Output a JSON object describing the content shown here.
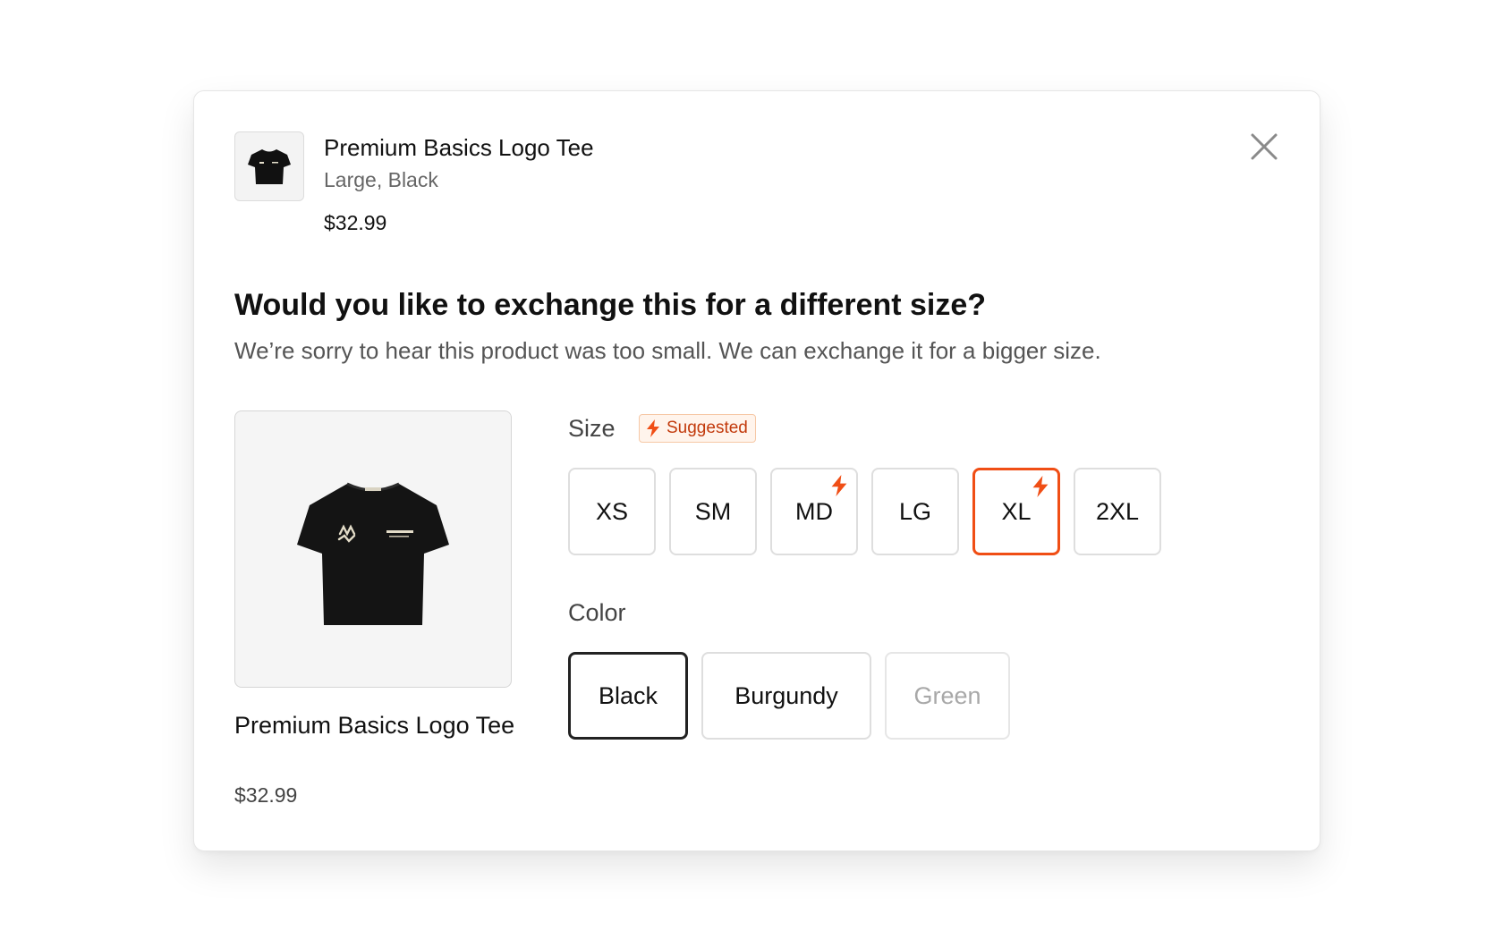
{
  "item": {
    "name": "Premium Basics Logo Tee",
    "variant": "Large, Black",
    "price": "$32.99"
  },
  "exchange": {
    "heading": "Would you like to exchange this for a different size?",
    "subtext": "We’re sorry to hear this product was too small. We can exchange it for a bigger size."
  },
  "product": {
    "name": "Premium Basics Logo Tee",
    "price": "$32.99",
    "image_icon": "tshirt-icon"
  },
  "size_section": {
    "label": "Size",
    "badge": "Suggested",
    "badge_icon": "lightning-icon",
    "options": [
      {
        "label": "XS",
        "suggested": false,
        "selected": false
      },
      {
        "label": "SM",
        "suggested": false,
        "selected": false
      },
      {
        "label": "MD",
        "suggested": true,
        "selected": false
      },
      {
        "label": "LG",
        "suggested": false,
        "selected": false
      },
      {
        "label": "XL",
        "suggested": true,
        "selected": true
      },
      {
        "label": "2XL",
        "suggested": false,
        "selected": false
      }
    ]
  },
  "color_section": {
    "label": "Color",
    "options": [
      {
        "label": "Black",
        "selected": true,
        "disabled": false
      },
      {
        "label": "Burgundy",
        "selected": false,
        "disabled": false
      },
      {
        "label": "Green",
        "selected": false,
        "disabled": true
      }
    ]
  },
  "colors": {
    "accent": "#f04e15",
    "badge_bg": "#fff4ec",
    "badge_text": "#c23a0c",
    "selected_border": "#222222",
    "disabled_text": "#a8a8a8"
  }
}
